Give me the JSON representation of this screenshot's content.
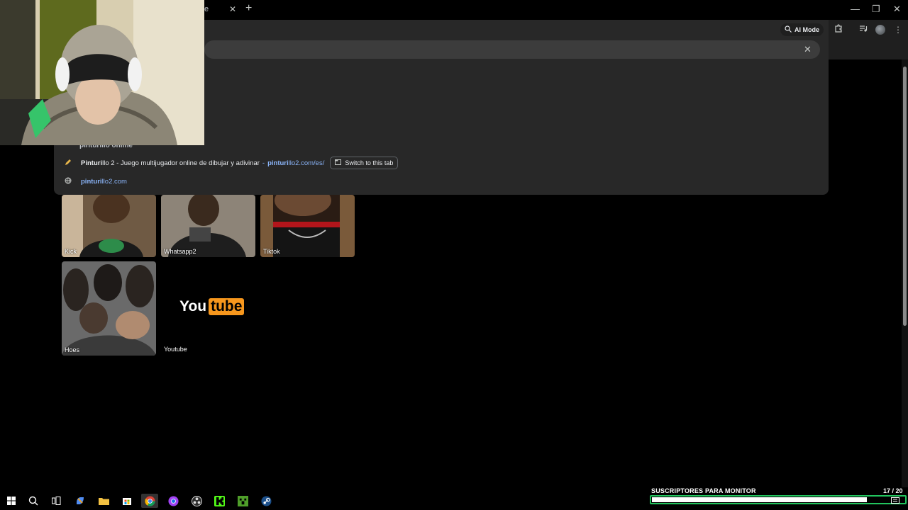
{
  "browser": {
    "tab_title_fragment": "e",
    "ai_mode_label": "AI Mode",
    "omnibox": {
      "partial_previous_row": "pinturillo online",
      "suggestions": [
        {
          "icon": "pencil-favicon",
          "title_bold": "Pinturi",
          "title_rest": "llo 2 - Juego multijugador online de dibujar y adivinar",
          "url_bold": "pinturi",
          "url_rest": "llo2.com/es/",
          "action": "Switch to this tab"
        },
        {
          "icon": "globe-icon",
          "url_bold": "pinturi",
          "url_rest": "llo2.com"
        }
      ]
    }
  },
  "new_tab": {
    "shortcuts": [
      {
        "label": "Kick"
      },
      {
        "label": "Whatsapp2"
      },
      {
        "label": "Tiktok"
      },
      {
        "label": "Hoes"
      },
      {
        "label": "Youtube",
        "logo_white": "You",
        "logo_orange": "tube"
      }
    ]
  },
  "overlay": {
    "goal_title": "SUSCRIPTORES PARA MONITOR",
    "goal_count": "17  / 20",
    "goal_current": 17,
    "goal_target": 20
  },
  "colors": {
    "omnibox_bg": "#282828",
    "link": "#8ab4f8",
    "goal_border": "#22c55e",
    "youtube_accent": "#f7971d"
  }
}
